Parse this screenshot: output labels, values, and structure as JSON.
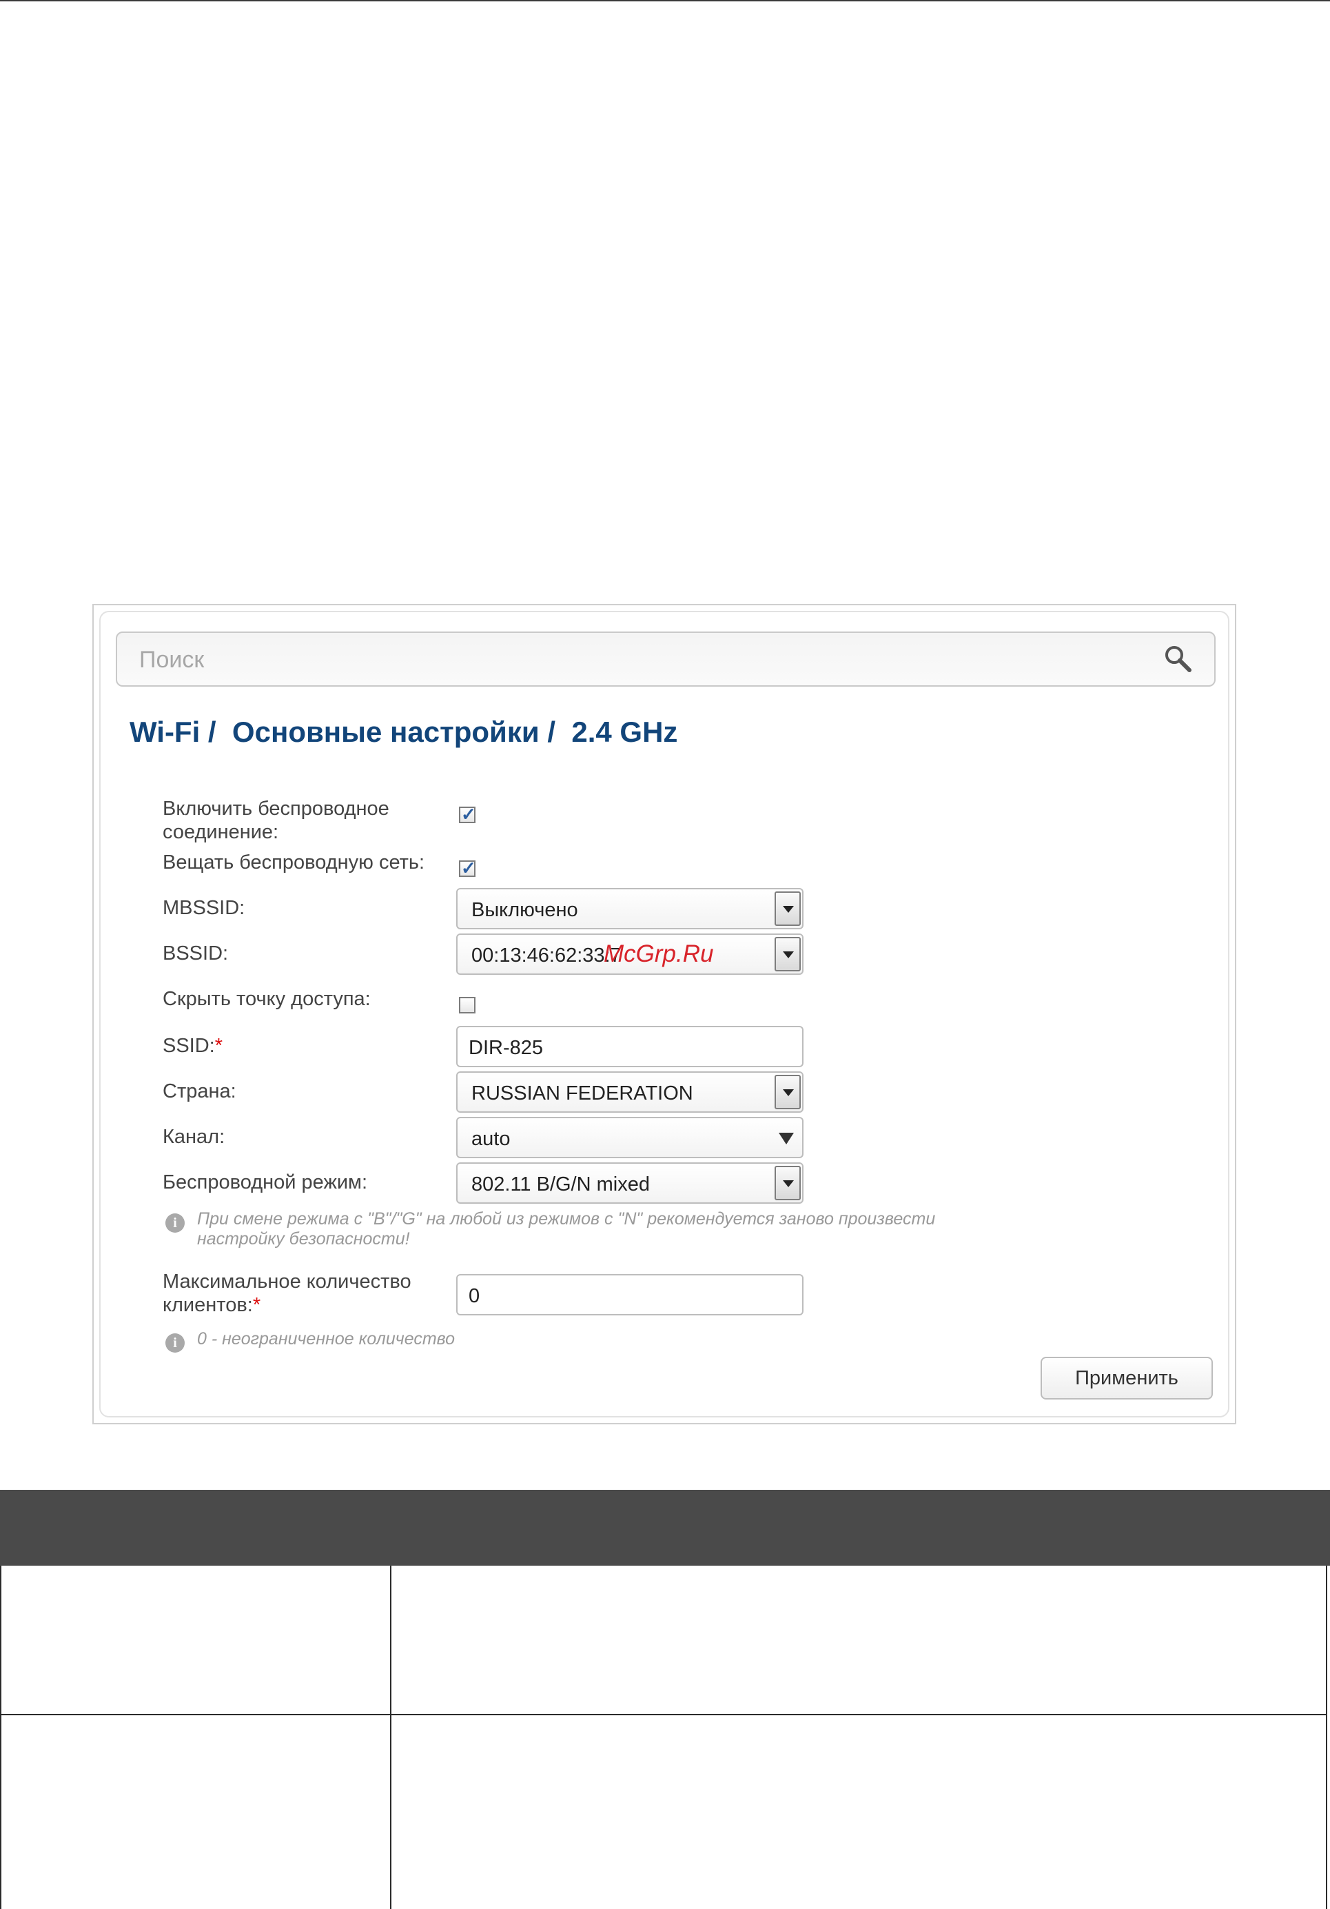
{
  "search": {
    "placeholder": "Поиск"
  },
  "title": "Wi-Fi /  Основные настройки /  2.4 GHz",
  "form": {
    "enable_label": "Включить беспроводное соединение:",
    "broadcast_label": "Вещать беспроводную сеть:",
    "mbssid_label": "MBSSID:",
    "mbssid_value": "Выключено",
    "bssid_label": "BSSID:",
    "bssid_value": "00:13:46:62:33:7",
    "hide_label": "Скрыть точку доступа:",
    "ssid_label": "SSID:",
    "ssid_value": "DIR-825",
    "country_label": "Страна:",
    "country_value": "RUSSIAN FEDERATION",
    "channel_label": "Канал:",
    "channel_value": "auto",
    "mode_label": "Беспроводной режим:",
    "mode_value": "802.11 B/G/N mixed",
    "mode_note": "При смене режима с \"B\"/\"G\" на любой из режимов с \"N\" рекомендуется заново произвести настройку безопасности!",
    "max_clients_label": "Максимальное количество клиентов:",
    "max_clients_value": "0",
    "max_clients_note": "0 - неограниченное количество",
    "required_mark": "*",
    "apply_label": "Применить"
  },
  "watermark": "McGrp.Ru",
  "checkboxes": {
    "enable": true,
    "broadcast": true,
    "hide": false
  }
}
